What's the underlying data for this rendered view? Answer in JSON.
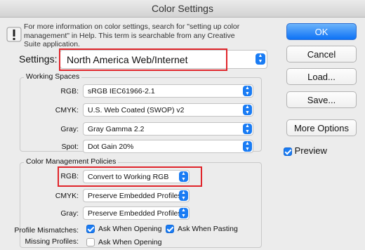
{
  "window": {
    "title": "Color Settings"
  },
  "info": {
    "text": "For more information on color settings, search for \"setting up color management\" in Help. This term is searchable from any Creative Suite application."
  },
  "buttons": {
    "ok": "OK",
    "cancel": "Cancel",
    "load": "Load...",
    "save": "Save...",
    "more_options": "More Options"
  },
  "preview": {
    "label": "Preview",
    "checked": true
  },
  "settings": {
    "label": "Settings:",
    "value": "North America Web/Internet"
  },
  "working_spaces": {
    "title": "Working Spaces",
    "rows": [
      {
        "label": "RGB:",
        "value": "sRGB IEC61966-2.1"
      },
      {
        "label": "CMYK:",
        "value": "U.S. Web Coated (SWOP) v2"
      },
      {
        "label": "Gray:",
        "value": "Gray Gamma 2.2"
      },
      {
        "label": "Spot:",
        "value": "Dot Gain 20%"
      }
    ]
  },
  "policies": {
    "title": "Color Management Policies",
    "rows": [
      {
        "label": "RGB:",
        "value": "Convert to Working RGB"
      },
      {
        "label": "CMYK:",
        "value": "Preserve Embedded Profiles"
      },
      {
        "label": "Gray:",
        "value": "Preserve Embedded Profiles"
      }
    ],
    "profile_mismatches": {
      "label": "Profile Mismatches:",
      "opening": "Ask When Opening",
      "pasting": "Ask When Pasting"
    },
    "missing_profiles": {
      "label": "Missing Profiles:",
      "opening": "Ask When Opening"
    }
  },
  "colors": {
    "accent": "#1a7cf4",
    "highlight": "#e0252b"
  }
}
